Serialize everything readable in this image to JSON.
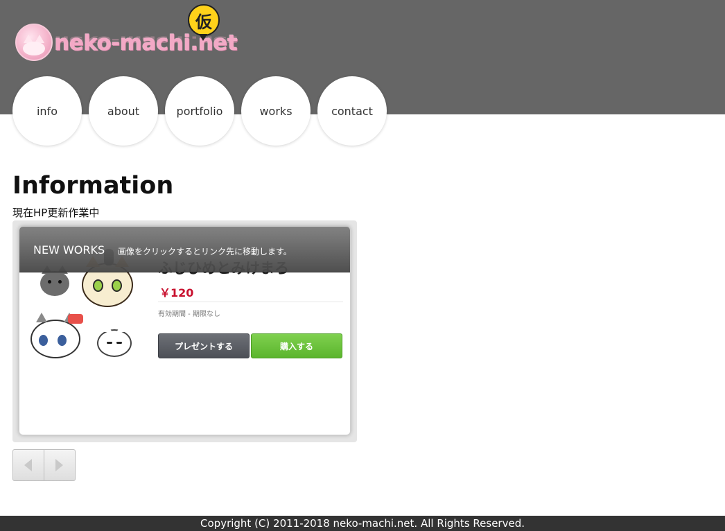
{
  "site": {
    "logo_text": "neko-machi.net",
    "logo_badge": "仮"
  },
  "nav": {
    "items": [
      {
        "label": "info"
      },
      {
        "label": "about"
      },
      {
        "label": "portfolio"
      },
      {
        "label": "works"
      },
      {
        "label": "contact"
      }
    ]
  },
  "main": {
    "title": "Information",
    "subtitle": "現在HP更新作業中"
  },
  "slider": {
    "overlay_title": "NEW WORKS",
    "overlay_note": "画像をクリックするとリンク先に移動します。",
    "product": {
      "name": "ふじひめとみけまろ",
      "price": "￥120",
      "validity": "有効期間 - 期限なし",
      "gift_label": "プレゼントする",
      "buy_label": "購入する"
    }
  },
  "footer": {
    "copyright": "Copyright (C) 2011-2018 neko-machi.net. All Rights Reserved."
  }
}
